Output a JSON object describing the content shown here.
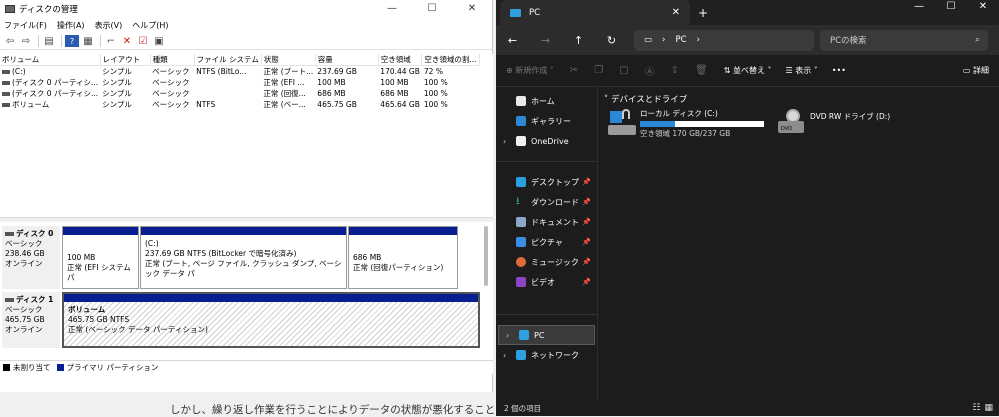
{
  "disk_mgmt": {
    "title": "ディスクの管理",
    "menu": [
      "ファイル(F)",
      "操作(A)",
      "表示(V)",
      "ヘルプ(H)"
    ],
    "columns": [
      "ボリューム",
      "レイアウト",
      "種類",
      "ファイル システム",
      "状態",
      "容量",
      "空き領域",
      "空き領域の割..."
    ],
    "rows": [
      [
        "(C:)",
        "シンプル",
        "ベーシック",
        "NTFS (BitLo...",
        "正常 (ブート...",
        "237.69 GB",
        "170.44 GB",
        "72 %"
      ],
      [
        "(ディスク 0 パーティシ...",
        "シンプル",
        "ベーシック",
        "",
        "正常 (EFI ...",
        "100 MB",
        "100 MB",
        "100 %"
      ],
      [
        "(ディスク 0 パーティシ...",
        "シンプル",
        "ベーシック",
        "",
        "正常 (回復...",
        "686 MB",
        "686 MB",
        "100 %"
      ],
      [
        "ボリューム",
        "シンプル",
        "ベーシック",
        "NTFS",
        "正常 (ベー...",
        "465.75 GB",
        "465.64 GB",
        "100 %"
      ]
    ],
    "disk0": {
      "name": "ディスク 0",
      "type": "ベーシック",
      "size": "238.46 GB",
      "status": "オンライン",
      "p1_size": "100 MB",
      "p1_status": "正常 (EFI システム パ",
      "p2_name": "(C:)",
      "p2_size": "237.69 GB NTFS (BitLocker で暗号化済み)",
      "p2_status": "正常 (ブート, ページ ファイル, クラッシュ ダンプ, ベーシック データ パ",
      "p3_size": "686 MB",
      "p3_status": "正常 (回復パーティション)"
    },
    "disk1": {
      "name": "ディスク 1",
      "type": "ベーシック",
      "size": "465.75 GB",
      "status": "オンライン",
      "p1_name": "ボリューム",
      "p1_size": "465.75 GB NTFS",
      "p1_status": "正常 (ベーシック データ パーティション)"
    },
    "legend": [
      "未割り当て",
      "プライマリ パーティション"
    ],
    "legend_colors": [
      "#000000",
      "#0a1f8f"
    ]
  },
  "background_text": "しかし、繰り返し作業を行うことによりデータの状態が悪化すること",
  "explorer": {
    "tab_title": "PC",
    "address": "PC",
    "search_placeholder": "PCの検索",
    "cmd": {
      "new": "新規作成",
      "sort": "並べ替え",
      "view": "表示",
      "more": "•••",
      "details": "詳細"
    },
    "sidebar": {
      "home": "ホーム",
      "gallery": "ギャラリー",
      "onedrive": "OneDrive",
      "desktop": "デスクトップ",
      "downloads": "ダウンロード",
      "documents": "ドキュメント",
      "pictures": "ピクチャ",
      "music": "ミュージック",
      "videos": "ビデオ",
      "pc": "PC",
      "network": "ネットワーク"
    },
    "group_header": "デバイスとドライブ",
    "drive_c": {
      "name": "ローカル ディスク (C:)",
      "free": "空き領域 170 GB/237 GB",
      "used_fraction": 0.28
    },
    "drive_d": {
      "name": "DVD RW ドライブ (D:)",
      "label": "DVD"
    },
    "status": "2 個の項目"
  }
}
